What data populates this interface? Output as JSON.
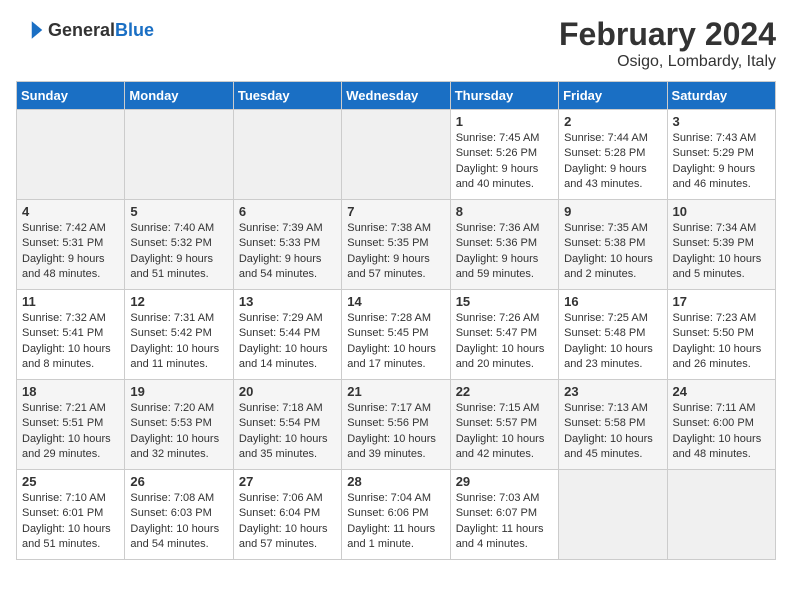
{
  "header": {
    "logo": {
      "general": "General",
      "blue": "Blue",
      "icon": "▶"
    },
    "title": "February 2024",
    "subtitle": "Osigo, Lombardy, Italy"
  },
  "weekdays": [
    "Sunday",
    "Monday",
    "Tuesday",
    "Wednesday",
    "Thursday",
    "Friday",
    "Saturday"
  ],
  "weeks": [
    [
      {
        "day": "",
        "info": ""
      },
      {
        "day": "",
        "info": ""
      },
      {
        "day": "",
        "info": ""
      },
      {
        "day": "",
        "info": ""
      },
      {
        "day": "1",
        "info": "Sunrise: 7:45 AM\nSunset: 5:26 PM\nDaylight: 9 hours\nand 40 minutes."
      },
      {
        "day": "2",
        "info": "Sunrise: 7:44 AM\nSunset: 5:28 PM\nDaylight: 9 hours\nand 43 minutes."
      },
      {
        "day": "3",
        "info": "Sunrise: 7:43 AM\nSunset: 5:29 PM\nDaylight: 9 hours\nand 46 minutes."
      }
    ],
    [
      {
        "day": "4",
        "info": "Sunrise: 7:42 AM\nSunset: 5:31 PM\nDaylight: 9 hours\nand 48 minutes."
      },
      {
        "day": "5",
        "info": "Sunrise: 7:40 AM\nSunset: 5:32 PM\nDaylight: 9 hours\nand 51 minutes."
      },
      {
        "day": "6",
        "info": "Sunrise: 7:39 AM\nSunset: 5:33 PM\nDaylight: 9 hours\nand 54 minutes."
      },
      {
        "day": "7",
        "info": "Sunrise: 7:38 AM\nSunset: 5:35 PM\nDaylight: 9 hours\nand 57 minutes."
      },
      {
        "day": "8",
        "info": "Sunrise: 7:36 AM\nSunset: 5:36 PM\nDaylight: 9 hours\nand 59 minutes."
      },
      {
        "day": "9",
        "info": "Sunrise: 7:35 AM\nSunset: 5:38 PM\nDaylight: 10 hours\nand 2 minutes."
      },
      {
        "day": "10",
        "info": "Sunrise: 7:34 AM\nSunset: 5:39 PM\nDaylight: 10 hours\nand 5 minutes."
      }
    ],
    [
      {
        "day": "11",
        "info": "Sunrise: 7:32 AM\nSunset: 5:41 PM\nDaylight: 10 hours\nand 8 minutes."
      },
      {
        "day": "12",
        "info": "Sunrise: 7:31 AM\nSunset: 5:42 PM\nDaylight: 10 hours\nand 11 minutes."
      },
      {
        "day": "13",
        "info": "Sunrise: 7:29 AM\nSunset: 5:44 PM\nDaylight: 10 hours\nand 14 minutes."
      },
      {
        "day": "14",
        "info": "Sunrise: 7:28 AM\nSunset: 5:45 PM\nDaylight: 10 hours\nand 17 minutes."
      },
      {
        "day": "15",
        "info": "Sunrise: 7:26 AM\nSunset: 5:47 PM\nDaylight: 10 hours\nand 20 minutes."
      },
      {
        "day": "16",
        "info": "Sunrise: 7:25 AM\nSunset: 5:48 PM\nDaylight: 10 hours\nand 23 minutes."
      },
      {
        "day": "17",
        "info": "Sunrise: 7:23 AM\nSunset: 5:50 PM\nDaylight: 10 hours\nand 26 minutes."
      }
    ],
    [
      {
        "day": "18",
        "info": "Sunrise: 7:21 AM\nSunset: 5:51 PM\nDaylight: 10 hours\nand 29 minutes."
      },
      {
        "day": "19",
        "info": "Sunrise: 7:20 AM\nSunset: 5:53 PM\nDaylight: 10 hours\nand 32 minutes."
      },
      {
        "day": "20",
        "info": "Sunrise: 7:18 AM\nSunset: 5:54 PM\nDaylight: 10 hours\nand 35 minutes."
      },
      {
        "day": "21",
        "info": "Sunrise: 7:17 AM\nSunset: 5:56 PM\nDaylight: 10 hours\nand 39 minutes."
      },
      {
        "day": "22",
        "info": "Sunrise: 7:15 AM\nSunset: 5:57 PM\nDaylight: 10 hours\nand 42 minutes."
      },
      {
        "day": "23",
        "info": "Sunrise: 7:13 AM\nSunset: 5:58 PM\nDaylight: 10 hours\nand 45 minutes."
      },
      {
        "day": "24",
        "info": "Sunrise: 7:11 AM\nSunset: 6:00 PM\nDaylight: 10 hours\nand 48 minutes."
      }
    ],
    [
      {
        "day": "25",
        "info": "Sunrise: 7:10 AM\nSunset: 6:01 PM\nDaylight: 10 hours\nand 51 minutes."
      },
      {
        "day": "26",
        "info": "Sunrise: 7:08 AM\nSunset: 6:03 PM\nDaylight: 10 hours\nand 54 minutes."
      },
      {
        "day": "27",
        "info": "Sunrise: 7:06 AM\nSunset: 6:04 PM\nDaylight: 10 hours\nand 57 minutes."
      },
      {
        "day": "28",
        "info": "Sunrise: 7:04 AM\nSunset: 6:06 PM\nDaylight: 11 hours\nand 1 minute."
      },
      {
        "day": "29",
        "info": "Sunrise: 7:03 AM\nSunset: 6:07 PM\nDaylight: 11 hours\nand 4 minutes."
      },
      {
        "day": "",
        "info": ""
      },
      {
        "day": "",
        "info": ""
      }
    ]
  ]
}
